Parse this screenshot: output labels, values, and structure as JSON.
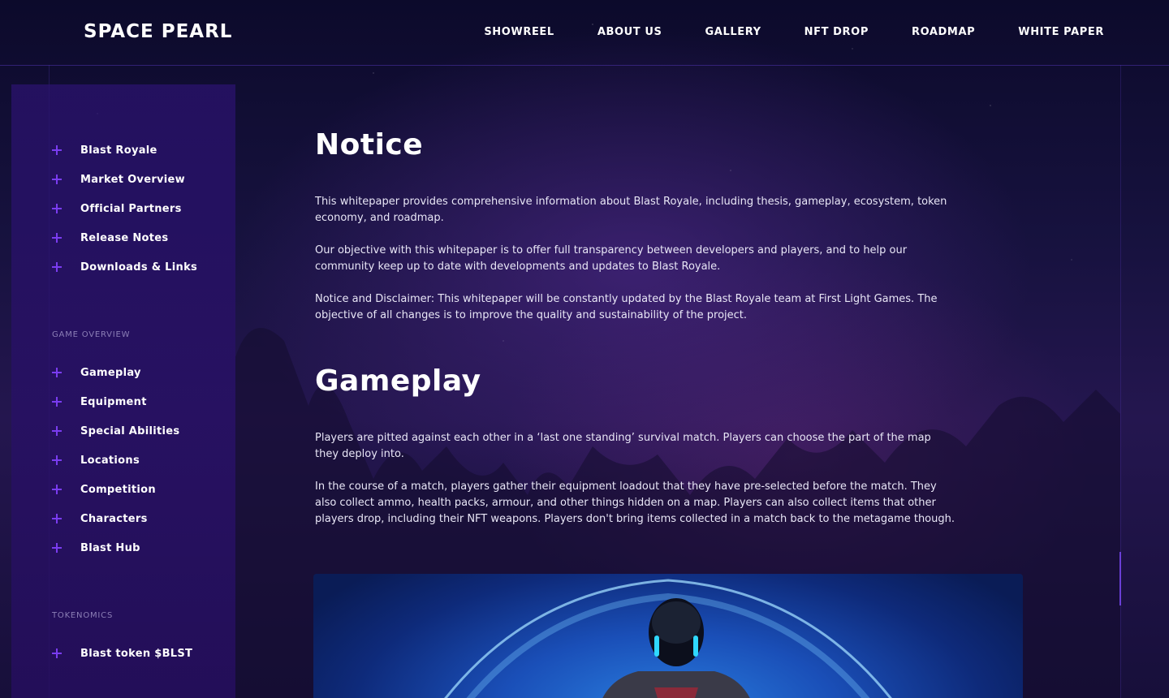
{
  "header": {
    "brand": "SPACE PEARL",
    "nav": [
      "SHOWREEL",
      "ABOUT US",
      "GALLERY",
      "NFT DROP",
      "ROADMAP",
      "WHITE PAPER"
    ]
  },
  "sidebar": {
    "intro_items": [
      "Blast Royale",
      "Market Overview",
      "Official Partners",
      "Release Notes",
      "Downloads & Links"
    ],
    "game_overview_title": "GAME OVERVIEW",
    "game_overview_items": [
      "Gameplay",
      "Equipment",
      "Special Abilities",
      "Locations",
      "Competition",
      "Characters",
      "Blast Hub"
    ],
    "tokenomics_title": "TOKENOMICS",
    "tokenomics_items": [
      "Blast token $BLST"
    ]
  },
  "notice": {
    "title": "Notice",
    "paragraphs": [
      "This whitepaper provides comprehensive information about Blast Royale, including thesis, gameplay, ecosystem, token economy, and roadmap.",
      "Our objective with this whitepaper is to offer full transparency between developers and players, and to help our community keep up to date with developments and updates to Blast Royale.",
      "Notice and Disclaimer: This whitepaper will be constantly updated by the Blast Royale team at First Light Games. The objective of all changes is to improve the quality and sustainability of the project."
    ]
  },
  "gameplay": {
    "title": "Gameplay",
    "paragraphs": [
      "Players are pitted against each other in a ‘last one standing’ survival match. Players can choose the part of the map they deploy into.",
      "In the course of a match, players gather their equipment loadout that they have pre-selected before the match. They also collect ammo, health packs, armour, and other things hidden on a map. Players can also collect items that other players drop, including their NFT weapons. Players don't bring items collected in a match back to the metagame though."
    ]
  },
  "colors": {
    "accent": "#7a3cf0",
    "background": "#17123f",
    "sidebar": "#2a126e"
  }
}
